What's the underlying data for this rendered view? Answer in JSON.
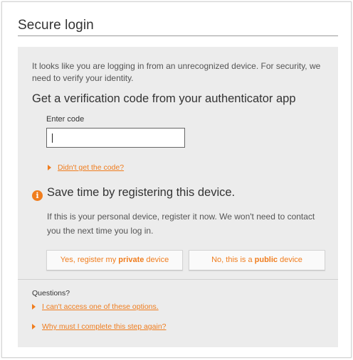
{
  "page": {
    "title": "Secure login"
  },
  "verification": {
    "intro_text": "It looks like you are logging in from an unrecognized device. For security, we need to verify your identity.",
    "heading": "Get a verification code from your authenticator app",
    "code_label": "Enter code",
    "code_value": "",
    "didnt_get_code_link": "Didn't get the code?"
  },
  "register": {
    "info_icon": "info-icon",
    "heading": "Save time by registering this device.",
    "description": "If this is your personal device, register it now. We won't need to contact you the next time you log in.",
    "private_button_prefix": "Yes, register my ",
    "private_button_bold": "private",
    "private_button_suffix": " device",
    "public_button_prefix": "No, this is a ",
    "public_button_bold": "public",
    "public_button_suffix": " device"
  },
  "help": {
    "label": "Questions?",
    "links": [
      "I can't access one of these options.",
      "Why must I complete this step again?"
    ]
  },
  "colors": {
    "accent": "#f07d1e",
    "panel_bg": "#ececec"
  }
}
